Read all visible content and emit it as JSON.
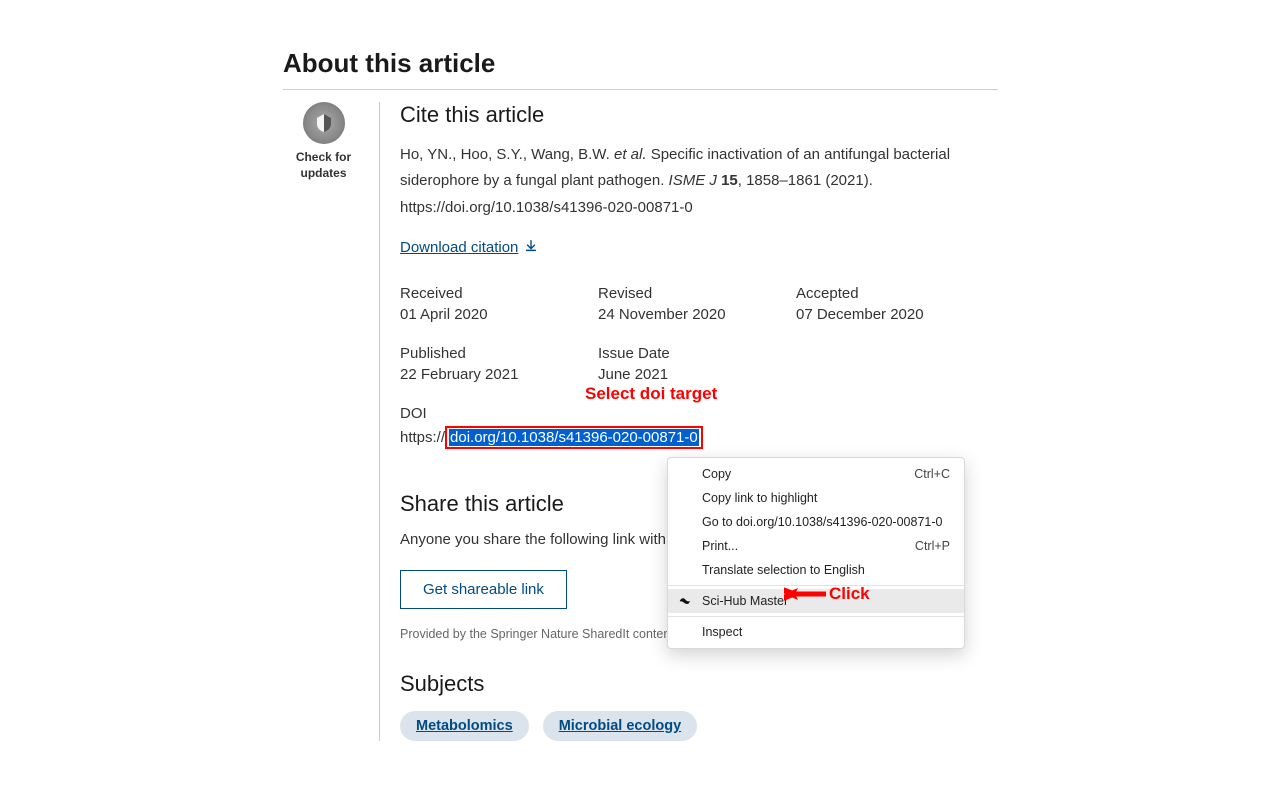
{
  "about_heading": "About this article",
  "check_updates": "Check for updates",
  "cite_heading": "Cite this article",
  "citation": {
    "authors": "Ho, YN., Hoo, S.Y., Wang, B.W.",
    "etal": "et al.",
    "title": "Specific inactivation of an antifungal bacterial siderophore by a fungal plant pathogen.",
    "journal": "ISME J",
    "volume": "15",
    "pages_year": ", 1858–1861 (2021). ",
    "doi_text": "https://doi.org/10.1038/s41396-020-00871-0"
  },
  "download_citation": "Download citation",
  "dates": {
    "received_label": "Received",
    "received_value": "01 April 2020",
    "revised_label": "Revised",
    "revised_value": "24 November 2020",
    "accepted_label": "Accepted",
    "accepted_value": "07 December 2020",
    "published_label": "Published",
    "published_value": "22 February 2021",
    "issuedate_label": "Issue Date",
    "issuedate_value": "June 2021"
  },
  "doi": {
    "label": "DOI",
    "prefix": "https://",
    "selected": "doi.org/10.1038/s41396-020-00871-0"
  },
  "annotations": {
    "select_doi": "Select doi target",
    "click": "Click"
  },
  "share": {
    "heading": "Share this article",
    "desc": "Anyone you share the following link with wil",
    "button": "Get shareable link",
    "provided": "Provided by the Springer Nature SharedIt content-sh"
  },
  "subjects_heading": "Subjects",
  "subjects": {
    "a": "Metabolomics",
    "b": "Microbial ecology"
  },
  "contextmenu": {
    "copy": "Copy",
    "copy_sc": "Ctrl+C",
    "copy_link": "Copy link to highlight",
    "goto": "Go to doi.org/10.1038/s41396-020-00871-0",
    "print": "Print...",
    "print_sc": "Ctrl+P",
    "translate": "Translate selection to English",
    "scihub": "Sci-Hub Master",
    "inspect": "Inspect"
  }
}
